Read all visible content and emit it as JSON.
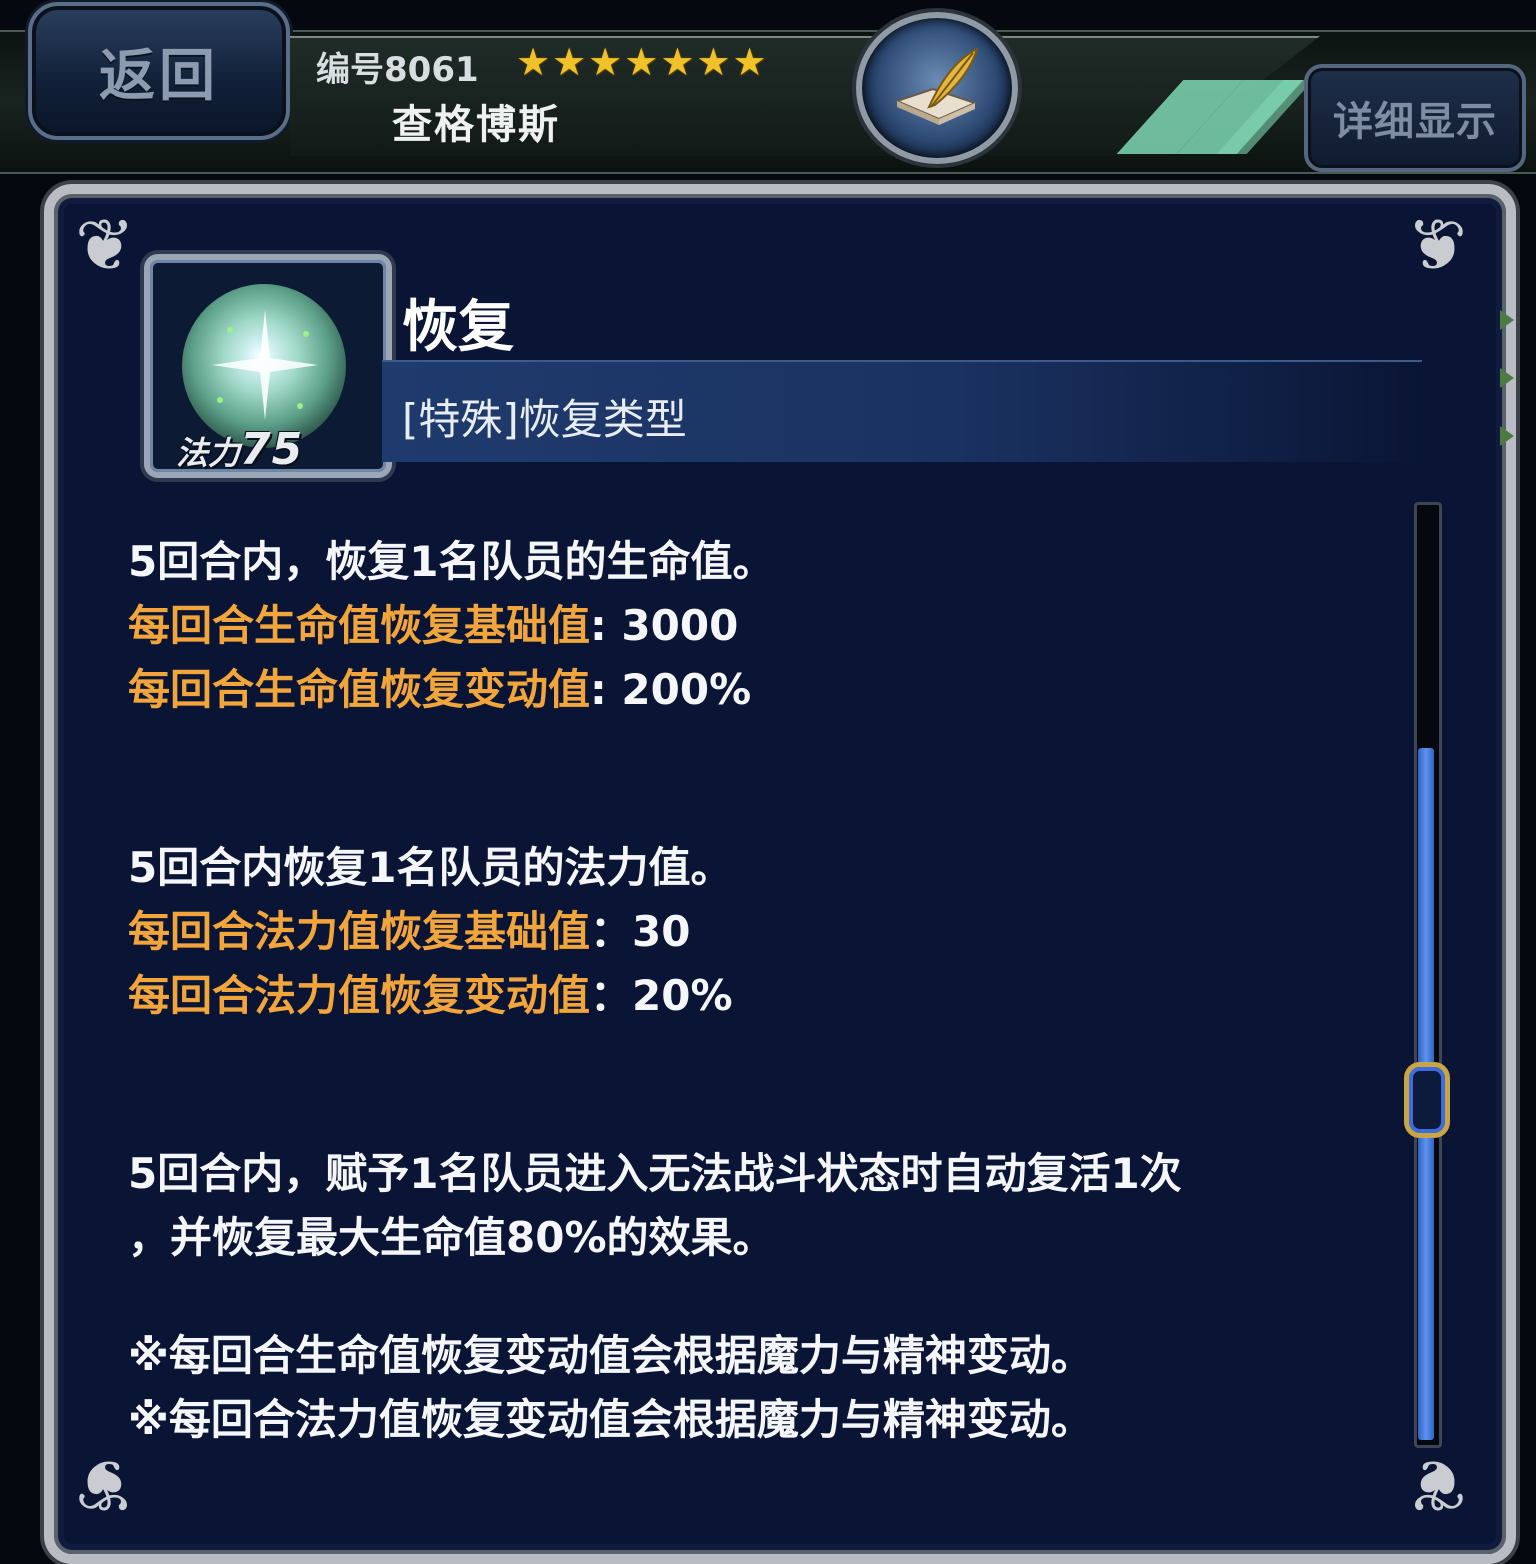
{
  "header": {
    "back_label": "返回",
    "char_id": "编号8061",
    "rarity_stars": 7,
    "char_name": "查格博斯",
    "detail_label": "详细显示"
  },
  "skill": {
    "name": "恢复",
    "type": "[特殊]恢复类型",
    "mp_label": "法力",
    "mp_cost": "75"
  },
  "description": {
    "block1": {
      "text": "5回合内，恢复1名队员的生命值。",
      "stat1_key": "每回合生命值恢复基础值",
      "stat1_val": ": 3000",
      "stat2_key": "每回合生命值恢复变动值",
      "stat2_val": ": 200%"
    },
    "block2": {
      "text": "5回合内恢复1名队员的法力值。",
      "stat1_key": "每回合法力值恢复基础值",
      "stat1_val": "：30",
      "stat2_key": "每回合法力值恢复变动值",
      "stat2_val": "：20%"
    },
    "block3": {
      "line1": "5回合内，赋予1名队员进入无法战斗状态时自动复活1次",
      "line2": "，并恢复最大生命值80%的效果。"
    },
    "notes": {
      "note1": "※每回合生命值恢复变动值会根据魔力与精神变动。",
      "note2": "※每回合法力值恢复变动值会根据魔力与精神变动。"
    }
  },
  "colors": {
    "accent_orange": "#f1a53a",
    "panel_bg": "#0a1535",
    "star_gold": "#f0c22a",
    "scroll_blue": "#4a80e0"
  },
  "scroll": {
    "position_fraction": 0.6
  }
}
